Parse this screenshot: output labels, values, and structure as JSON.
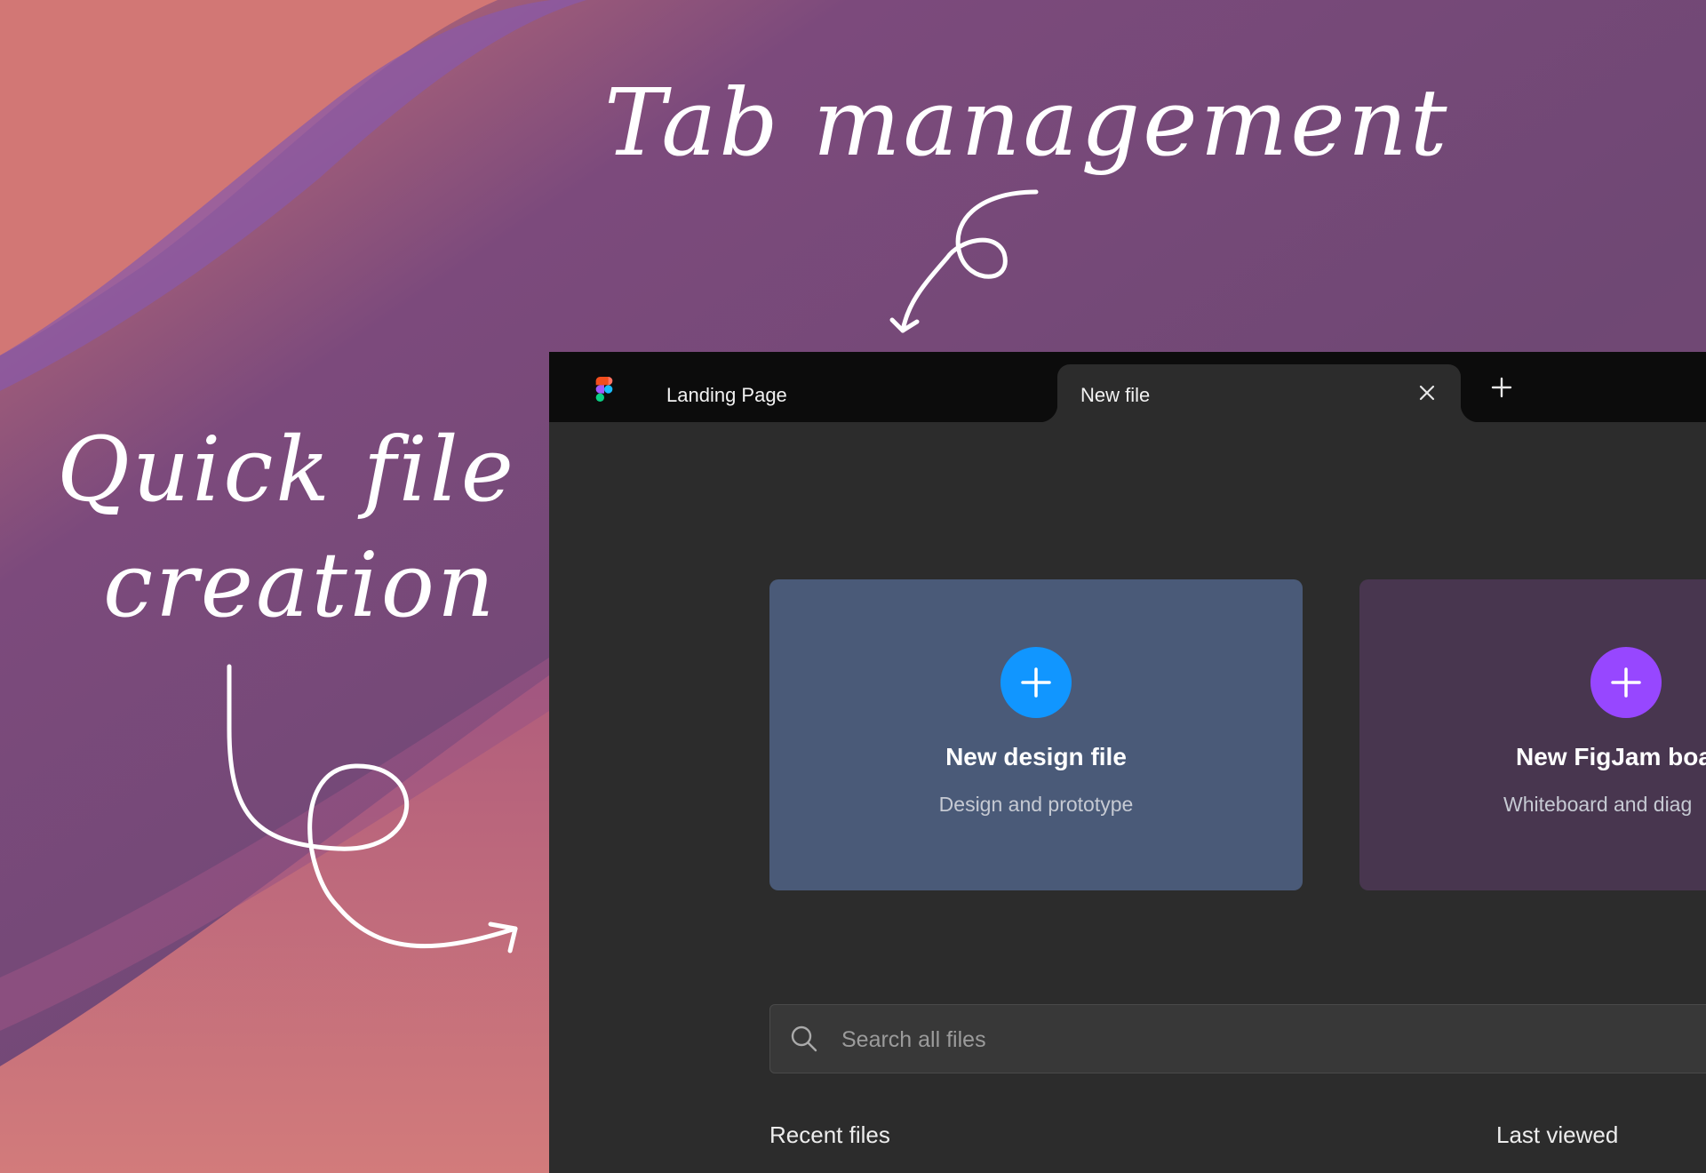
{
  "annotations": {
    "tab_management": "Tab management",
    "quick_file_line1": "Quick file",
    "quick_file_line2": "creation"
  },
  "tabs": [
    {
      "label": "Landing Page",
      "active": false
    },
    {
      "label": "New file",
      "active": true
    }
  ],
  "cards": {
    "design": {
      "title": "New design file",
      "subtitle": "Design and prototype",
      "color": "#1196ff"
    },
    "figjam": {
      "title": "New FigJam boa",
      "subtitle": "Whiteboard and diag",
      "color": "#9747ff"
    }
  },
  "search": {
    "placeholder": "Search all files"
  },
  "files": {
    "recent_label": "Recent files",
    "sort_label": "Last viewed"
  },
  "icons": {
    "logo": "figma-logo-icon",
    "close": "close-icon",
    "add": "plus-icon",
    "search": "search-icon"
  }
}
